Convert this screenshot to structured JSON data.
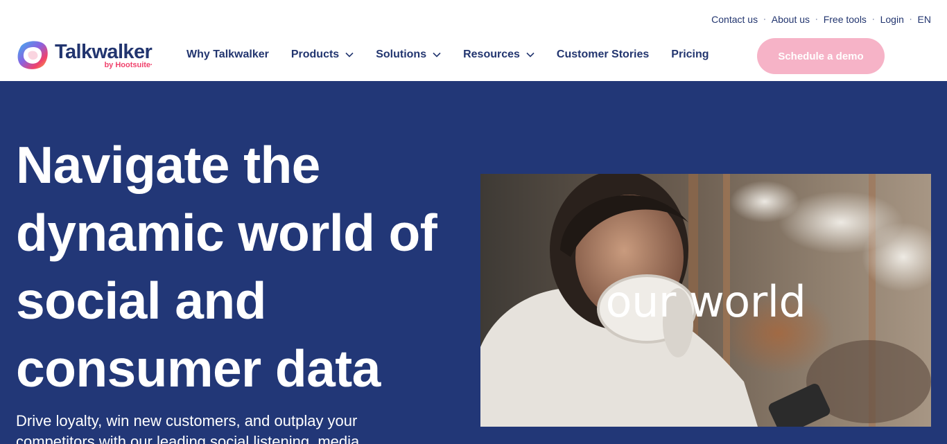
{
  "utility_nav": {
    "contact": "Contact us",
    "about": "About us",
    "free_tools": "Free tools",
    "login": "Login",
    "language": "EN",
    "separator": "·"
  },
  "brand": {
    "name": "Talkwalker",
    "sub": "by Hootsuite",
    "sub_mark": "•",
    "colors": {
      "navy": "#22356f",
      "pink": "#f0426c"
    }
  },
  "main_nav": {
    "why": "Why Talkwalker",
    "products": "Products",
    "solutions": "Solutions",
    "resources": "Resources",
    "stories": "Customer Stories",
    "pricing": "Pricing"
  },
  "cta": {
    "label": "Schedule a demo",
    "color": "#f6b3c7"
  },
  "hero": {
    "background": "#223777",
    "title": "Navigate the dynamic world of social and consumer data",
    "subtitle": "Drive loyalty, win new customers, and outplay your competitors with our leading social listening, media",
    "media_overlay_text": "our world"
  },
  "icons": {
    "logo": "talkwalker-logo-icon",
    "chevron": "chevron-down-icon"
  }
}
